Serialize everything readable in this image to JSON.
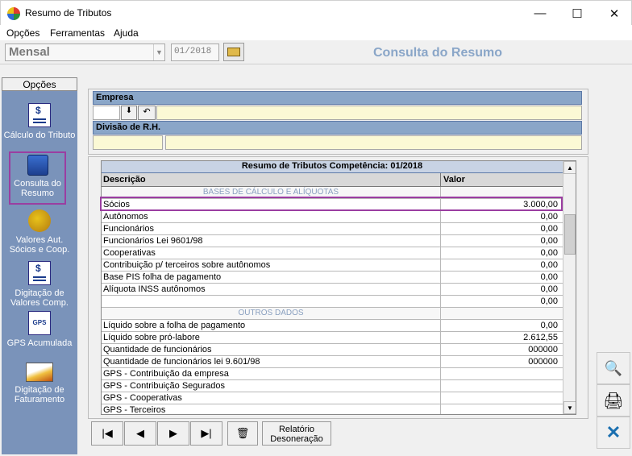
{
  "window": {
    "title": "Resumo de Tributos",
    "minimize": "—",
    "maximize": "☐",
    "close": "✕"
  },
  "menu": {
    "opcoes": "Opções",
    "ferramentas": "Ferramentas",
    "ajuda": "Ajuda"
  },
  "toolbar": {
    "period_type": "Mensal",
    "competencia": "01/2018",
    "page_title": "Consulta do Resumo"
  },
  "sidebar": {
    "header": "Opções",
    "items": [
      {
        "label": "Cálculo do Tributo",
        "icon": "calc-tax-icon"
      },
      {
        "label": "Consulta do Resumo",
        "icon": "query-summary-icon",
        "selected": true
      },
      {
        "label": "Valores Aut. Sócios e Coop.",
        "icon": "partners-values-icon"
      },
      {
        "label": "Digitação de Valores Comp.",
        "icon": "typing-values-icon"
      },
      {
        "label": "GPS Acumulada",
        "icon": "gps-icon"
      },
      {
        "label": "Digitação de Faturamento",
        "icon": "billing-icon"
      }
    ]
  },
  "empresa": {
    "label": "Empresa",
    "codigo": "",
    "nome": ""
  },
  "divisao": {
    "label": "Divisão de R.H.",
    "codigo": "",
    "nome": ""
  },
  "grid": {
    "title": "Resumo de Tributos Competência: 01/2018",
    "col_descricao": "Descrição",
    "col_valor": "Valor",
    "section1": "BASES DE CÁLCULO E ALÍQUOTAS",
    "section2": "OUTROS DADOS",
    "rows": [
      {
        "d": "Sócios",
        "v": "3.000,00"
      },
      {
        "d": "Autônomos",
        "v": "0,00"
      },
      {
        "d": "Funcionários",
        "v": "0,00"
      },
      {
        "d": "Funcionários Lei 9601/98",
        "v": "0,00"
      },
      {
        "d": "Cooperativas",
        "v": "0,00"
      },
      {
        "d": "Contribuição p/ terceiros sobre autônomos",
        "v": "0,00"
      },
      {
        "d": "Base PIS folha de pagamento",
        "v": "0,00"
      },
      {
        "d": "Alíquota INSS autônomos",
        "v": "0,00"
      },
      {
        "d": "",
        "v": "0,00"
      },
      {
        "d": "Líquido sobre a folha de pagamento",
        "v": "0,00"
      },
      {
        "d": "Líquido sobre pró-labore",
        "v": "2.612,55"
      },
      {
        "d": "Quantidade de funcionários",
        "v": "000000"
      },
      {
        "d": "Quantidade de funcionários lei 9.601/98",
        "v": "000000"
      },
      {
        "d": "GPS - Contribuição da empresa",
        "v": ""
      },
      {
        "d": "GPS - Contribuição Segurados",
        "v": ""
      },
      {
        "d": "GPS - Cooperativas",
        "v": ""
      },
      {
        "d": "GPS - Terceiros",
        "v": ""
      }
    ]
  },
  "footer": {
    "relatorio": "Relatório Desoneração"
  },
  "colors": {
    "accent": "#8aa6c8",
    "sidebar": "#7a93ba",
    "highlight": "#9b3ea1",
    "field": "#fbf9d5"
  }
}
